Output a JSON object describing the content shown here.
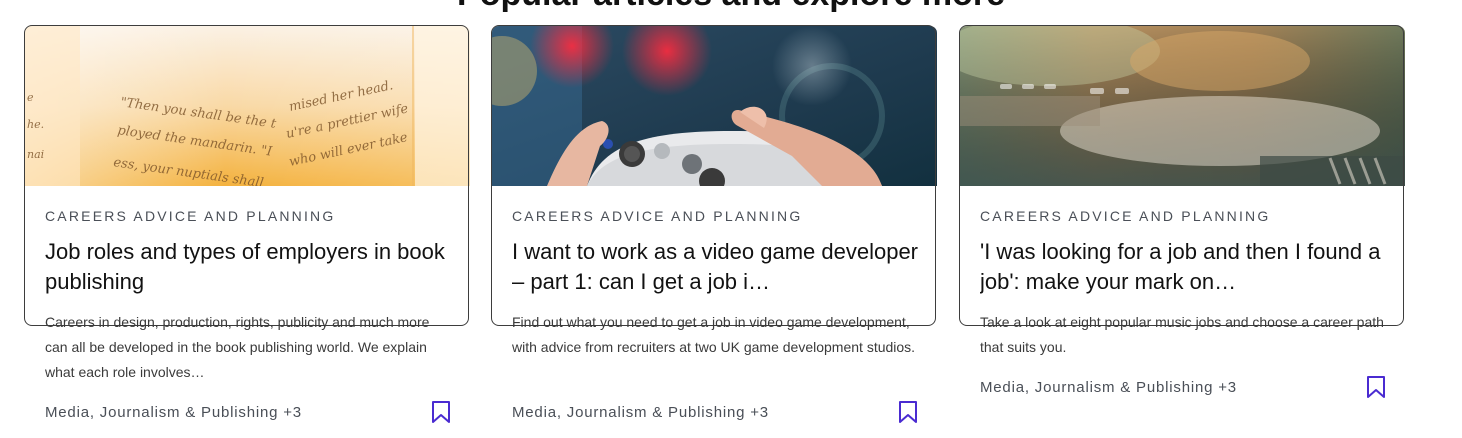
{
  "section": {
    "heading": "Popular articles and explore more"
  },
  "colors": {
    "accent": "#4a2bd1",
    "border": "#3d3d3d",
    "meta_text": "#4a4f57"
  },
  "cards": [
    {
      "image": "book-pages-photo",
      "category": "CAREERS ADVICE AND PLANNING",
      "title": "Job roles and types of employers in book publishing",
      "summary": "Careers in design, production, rights, publicity and much more can all be developed in the book publishing world. We explain what each role involves…",
      "tags": "Media, Journalism & Publishing +3",
      "bookmark_icon": "bookmark-icon"
    },
    {
      "image": "video-game-controller-photo",
      "category": "CAREERS ADVICE AND PLANNING",
      "title": "I want to work as a video game developer – part 1: can I get a job i…",
      "summary": "Find out what you need to get a job in video game development, with advice from recruiters at two UK game development studios.",
      "tags": "Media, Journalism & Publishing +3",
      "bookmark_icon": "bookmark-icon"
    },
    {
      "image": "music-mixing-desk-photo",
      "category": "CAREERS ADVICE AND PLANNING",
      "title": "'I was looking for a job and then I found a job': make your mark on…",
      "summary": "Take a look at eight popular music jobs and choose a career path that suits you.",
      "tags": "Media, Journalism & Publishing +3",
      "bookmark_icon": "bookmark-icon"
    }
  ]
}
